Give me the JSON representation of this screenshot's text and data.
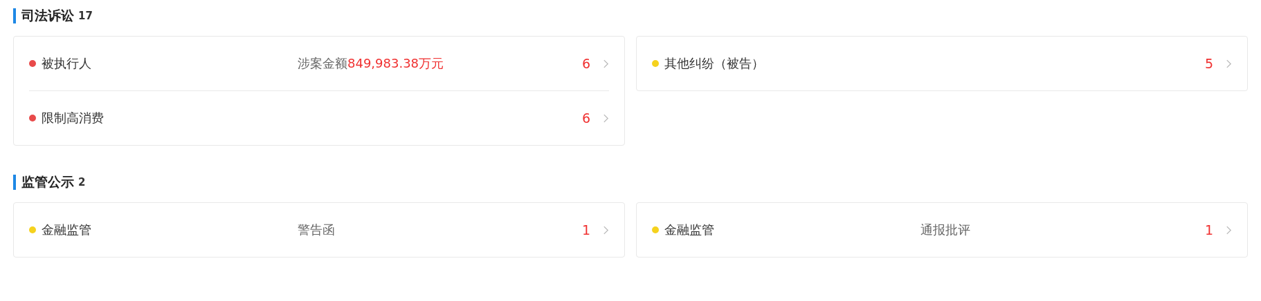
{
  "sections": [
    {
      "title": "司法诉讼",
      "count": "17",
      "cards": [
        {
          "rows": [
            {
              "label": "被执行人",
              "color": "#e84a4a",
              "detail": "涉案金额",
              "detail_amount": "849,983.38万元",
              "count": "6"
            },
            {
              "label": "限制高消费",
              "color": "#e84a4a",
              "count": "6"
            }
          ]
        },
        {
          "rows": [
            {
              "label": "其他纠纷（被告）",
              "color": "#f5d21e",
              "count": "5"
            }
          ]
        }
      ]
    },
    {
      "title": "监管公示",
      "count": "2",
      "cards": [
        {
          "rows": [
            {
              "label": "金融监管",
              "color": "#f5d21e",
              "detail": "警告函",
              "count": "1"
            }
          ]
        },
        {
          "rows": [
            {
              "label": "金融监管",
              "color": "#f5d21e",
              "detail": "通报批评",
              "count": "1"
            }
          ]
        }
      ]
    }
  ]
}
